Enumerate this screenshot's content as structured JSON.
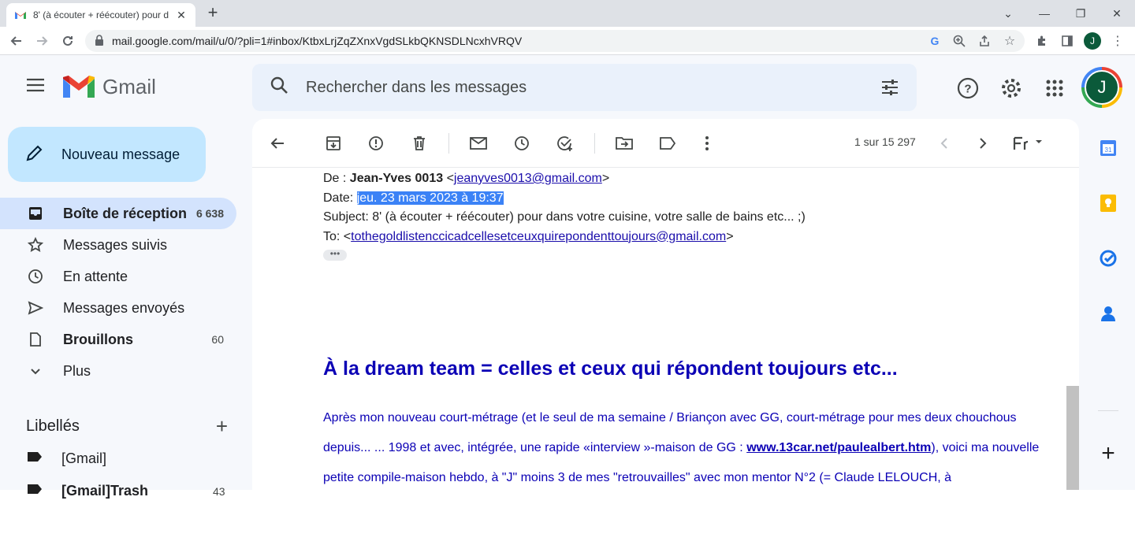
{
  "browser": {
    "tab_title": "8' (à écouter + réécouter) pour d",
    "url": "mail.google.com/mail/u/0/?pli=1#inbox/KtbxLrjZqZXnxVgdSLkbQKNSDLNcxhVRQV",
    "profile_initial": "J"
  },
  "gmail": {
    "logo_text": "Gmail",
    "search_placeholder": "Rechercher dans les messages",
    "avatar_initial": "J",
    "compose_label": "Nouveau message"
  },
  "nav": {
    "items": [
      {
        "label": "Boîte de réception",
        "count": "6 638",
        "icon": "inbox-icon"
      },
      {
        "label": "Messages suivis",
        "count": "",
        "icon": "star-icon"
      },
      {
        "label": "En attente",
        "count": "",
        "icon": "clock-icon"
      },
      {
        "label": "Messages envoyés",
        "count": "",
        "icon": "send-icon"
      },
      {
        "label": "Brouillons",
        "count": "60",
        "icon": "draft-icon"
      },
      {
        "label": "Plus",
        "count": "",
        "icon": "chevron-down-icon"
      }
    ],
    "labels_title": "Libellés",
    "labels": [
      {
        "label": "[Gmail]",
        "count": ""
      },
      {
        "label": "[Gmail]Trash",
        "count": "43"
      }
    ]
  },
  "toolbar": {
    "pager": "1 sur 15 297"
  },
  "message": {
    "from_prefix": "De : ",
    "from_name": "Jean-Yves 0013",
    "from_email": "jeanyves0013@gmail.com",
    "date_prefix": "Date: ",
    "date_value": "jeu. 23 mars 2023 à 19:37",
    "subject_line": "Subject: 8' (à écouter + réécouter) pour dans votre cuisine, votre salle de bains etc... ;)",
    "to_prefix": "To: <",
    "to_email": "tothegoldlistenccicadcellesetceuxquirepondenttoujours@gmail.com",
    "headline": "À la dream team = celles et ceux qui répondent toujours etc...",
    "para_1": "Après mon nouveau court-métrage (et le seul de ma semaine / Briançon avec GG, court-métrage pour mes deux chouchous depuis... ... 1998 et avec, intégrée, une rapide «interview »-maison de GG : ",
    "para_link": "www.13car.net/paulealbert.htm",
    "para_2": "), voici ma nouvelle petite compile-maison hebdo, à \"J\" moins 3 de mes \"retrouvailles\" avec mon mentor N°2 (= Claude LELOUCH, à"
  },
  "colors": {
    "compose_bg": "#c2e7ff",
    "active_nav_bg": "#d3e3fd",
    "search_bg": "#eaf1fb",
    "selection": "#3b82f6",
    "body_link": "#0b00b5"
  }
}
